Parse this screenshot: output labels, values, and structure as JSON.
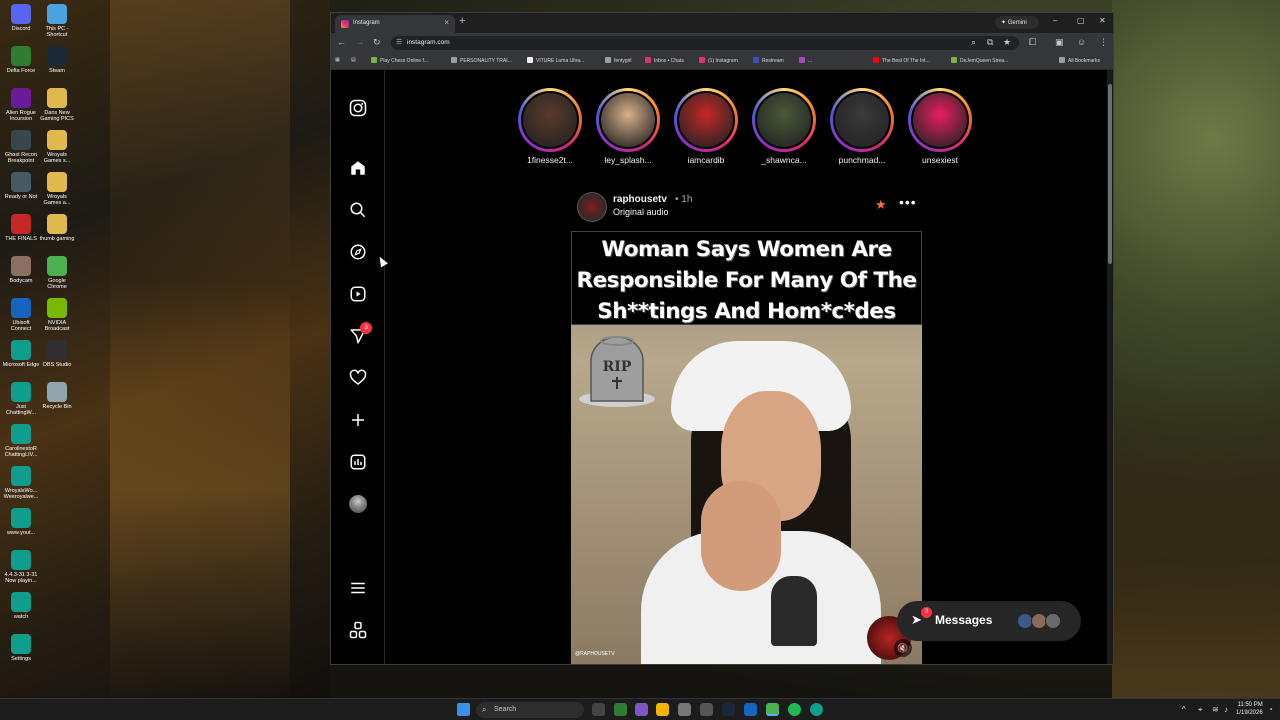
{
  "desktop": {
    "icons": [
      {
        "label": "Discord",
        "color": "#5865f2"
      },
      {
        "label": "This PC - Shortcut",
        "color": "#4aa3df"
      },
      {
        "label": "Delta Force",
        "color": "#2e7d32"
      },
      {
        "label": "Steam",
        "color": "#1b2838"
      },
      {
        "label": "Alien Rogue Incursion",
        "color": "#6a1b9a"
      },
      {
        "label": "Dans New Gaming PICS",
        "color": "#e0b84b"
      },
      {
        "label": "Ghost Recon Breakpoint",
        "color": "#37474f"
      },
      {
        "label": "Wroyals Games s...",
        "color": "#e0b84b"
      },
      {
        "label": "Ready or Not",
        "color": "#455a64"
      },
      {
        "label": "Wroyals Games a...",
        "color": "#e0b84b"
      },
      {
        "label": "THE FINALS",
        "color": "#c62828"
      },
      {
        "label": "thumb gaming",
        "color": "#e0b84b"
      },
      {
        "label": "Bodycam",
        "color": "#8d6e63"
      },
      {
        "label": "Google Chrome",
        "color": "#4caf50"
      },
      {
        "label": "Ubisoft Connect",
        "color": "#1565c0"
      },
      {
        "label": "NVIDIA Broadcast",
        "color": "#76b900"
      },
      {
        "label": "Microsoft Edge",
        "color": "#0f9d8e"
      },
      {
        "label": "OBS Studio",
        "color": "#302e31"
      },
      {
        "label": "Just ChattingW...",
        "color": "#0f9d8e"
      },
      {
        "label": "Recycle Bin",
        "color": "#90a4ae"
      },
      {
        "label": "CarolinestoR ChattingLIV...",
        "color": "#0f9d8e"
      },
      {
        "label": "WroyalsWo... Weeroyalwe...",
        "color": "#0f9d8e"
      },
      {
        "label": "www.yout...",
        "color": "#0f9d8e"
      },
      {
        "label": "4.4.3-31 3-31 Now playin...",
        "color": "#0f9d8e"
      },
      {
        "label": "watch",
        "color": "#0f9d8e"
      },
      {
        "label": "Settings",
        "color": "#0f9d8e"
      }
    ]
  },
  "browser": {
    "tab_title": "Instagram",
    "gemini_label": "Gemini",
    "url": "instagram.com",
    "bookmarks": [
      {
        "label": "Play Chess Online f...",
        "color": "#7cb342"
      },
      {
        "label": "PERSONALITY TRAI...",
        "color": "#9e9e9e"
      },
      {
        "label": "VITURE Luma Ultra...",
        "color": "#eeeeee"
      },
      {
        "label": "fentygirl",
        "color": "#9e9e9e"
      },
      {
        "label": "Inbox • Chats",
        "color": "#e1306c"
      },
      {
        "label": "(1) Instagram",
        "color": "#e1306c"
      },
      {
        "label": "Restream",
        "color": "#3f51b5"
      },
      {
        "label": "...",
        "color": "#ab47bc"
      },
      {
        "label": "The Best Of The Int...",
        "color": "#ff0000"
      },
      {
        "label": "DeJemQueen Strea...",
        "color": "#7cb342"
      },
      {
        "label": "All Bookmarks",
        "color": "#9e9e9e"
      }
    ]
  },
  "instagram": {
    "nav": {
      "notifications_badge": "3"
    },
    "stories": [
      {
        "name": "1finesse2t...",
        "color": "#5a3a2a"
      },
      {
        "name": "ley_splash...",
        "color": "#d8b08a"
      },
      {
        "name": "iamcardib",
        "color": "#c62828"
      },
      {
        "name": "_shawnca...",
        "color": "#4a5a3a"
      },
      {
        "name": "punchmad...",
        "color": "#3a3a3a"
      },
      {
        "name": "unsexiest",
        "color": "#e91e63"
      }
    ],
    "post": {
      "username": "raphousetv",
      "time": "• 1h",
      "audio": "Original audio",
      "headline": [
        "Woman Says Women Are",
        "Responsible For Many Of The",
        "Sh**tings And Hom*c*des"
      ],
      "rip_text": "RIP",
      "watermark": "@RAPHOUSETV"
    },
    "messages": {
      "label": "Messages",
      "badge": "3"
    }
  },
  "taskbar": {
    "search_placeholder": "Search",
    "time": "11:50 PM",
    "date": "1/19/2026"
  }
}
